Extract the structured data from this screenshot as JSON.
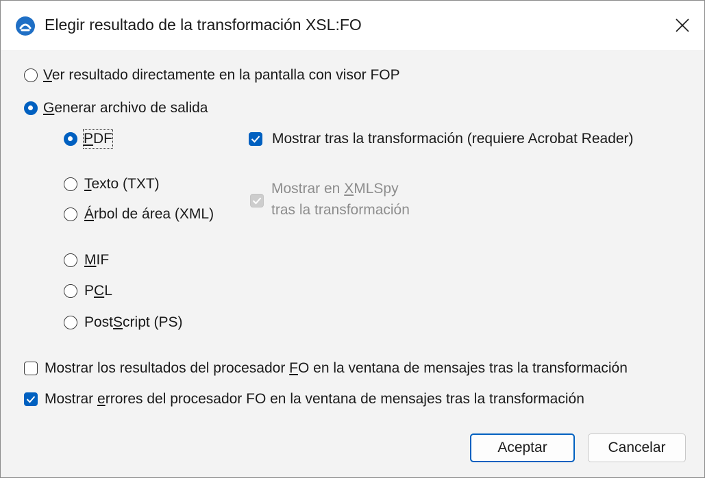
{
  "window": {
    "title": "Elegir resultado de la transformación XSL:FO",
    "app_icon": "altova-icon",
    "close_icon": "close-icon"
  },
  "view_fop": {
    "mnemonic": "V",
    "rest": "er resultado directamente en la pantalla con visor FOP",
    "selected": false
  },
  "generate_file": {
    "mnemonic": "G",
    "rest": "enerar archivo de salida",
    "selected": true
  },
  "formats": {
    "pdf": {
      "mnemonic": "P",
      "rest": "DF",
      "selected": true
    },
    "txt": {
      "mnemonic": "T",
      "rest": "exto (TXT)",
      "selected": false
    },
    "area_tree": {
      "mnemonic": "Á",
      "rest": "rbol de área (XML)",
      "selected": false
    },
    "mif": {
      "mnemonic": "M",
      "rest": "IF",
      "selected": false
    },
    "pcl": {
      "pre": "P",
      "mnemonic": "C",
      "rest": "L",
      "selected": false
    },
    "ps": {
      "pre": "Post",
      "mnemonic": "S",
      "rest": "cript (PS)",
      "selected": false
    }
  },
  "show_after_pdf": {
    "label": "Mostrar tras la transformación (requiere Acrobat Reader)",
    "checked": true
  },
  "show_in_xmlspy": {
    "line1_pre": "Mostrar en ",
    "line1_mnemonic": "X",
    "line1_rest": "MLSpy",
    "line2": "tras la transformación",
    "checked": true,
    "disabled": true
  },
  "show_results": {
    "pre": "Mostrar los resultados del procesador ",
    "mnemonic": "F",
    "rest": "O en la ventana de mensajes tras la transformación",
    "checked": false
  },
  "show_errors": {
    "pre": "Mostrar ",
    "mnemonic": "e",
    "rest": "rrores del procesador FO en la ventana de mensajes tras la transformación",
    "checked": true
  },
  "buttons": {
    "ok": "Aceptar",
    "cancel": "Cancelar"
  },
  "colors": {
    "accent": "#0060c0",
    "dialog_bg": "#f3f3f3",
    "disabled_text": "#8d8d8d"
  }
}
